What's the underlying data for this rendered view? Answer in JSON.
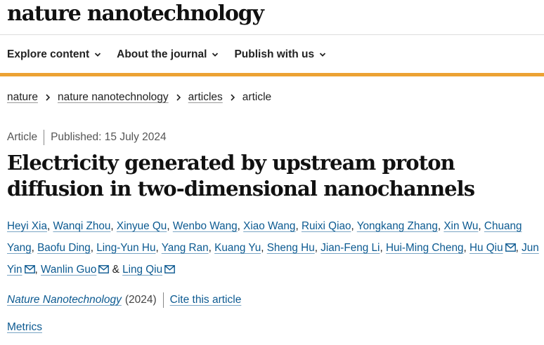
{
  "site": {
    "logo": "nature nanotechnology"
  },
  "nav": {
    "items": [
      {
        "label": "Explore content"
      },
      {
        "label": "About the journal"
      },
      {
        "label": "Publish with us"
      }
    ]
  },
  "breadcrumb": {
    "items": [
      "nature",
      "nature nanotechnology",
      "articles"
    ],
    "current": "article"
  },
  "article": {
    "type": "Article",
    "published": "Published: 15 July 2024",
    "title": "Electricity generated by upstream proton diffusion in two-dimensional nanochannels",
    "authors": [
      {
        "name": "Heyi Xia",
        "sep": ", ",
        "email": false
      },
      {
        "name": "Wanqi Zhou",
        "sep": ", ",
        "email": false
      },
      {
        "name": "Xinyue Qu",
        "sep": ", ",
        "email": false
      },
      {
        "name": "Wenbo Wang",
        "sep": ", ",
        "email": false
      },
      {
        "name": "Xiao Wang",
        "sep": ", ",
        "email": false
      },
      {
        "name": "Ruixi Qiao",
        "sep": ", ",
        "email": false
      },
      {
        "name": "Yongkang Zhang",
        "sep": ", ",
        "email": false
      },
      {
        "name": "Xin Wu",
        "sep": ", ",
        "email": false
      },
      {
        "name": "Chuang Yang",
        "sep": ", ",
        "email": false
      },
      {
        "name": "Baofu Ding",
        "sep": ", ",
        "email": false
      },
      {
        "name": "Ling-Yun Hu",
        "sep": ", ",
        "email": false
      },
      {
        "name": "Yang Ran",
        "sep": ", ",
        "email": false
      },
      {
        "name": "Kuang Yu",
        "sep": ", ",
        "email": false
      },
      {
        "name": "Sheng Hu",
        "sep": ", ",
        "email": false
      },
      {
        "name": "Jian-Feng Li",
        "sep": ", ",
        "email": false
      },
      {
        "name": "Hui-Ming Cheng",
        "sep": ", ",
        "email": false
      },
      {
        "name": "Hu Qiu",
        "sep": ", ",
        "email": true
      },
      {
        "name": "Jun Yin",
        "sep": ", ",
        "email": true
      },
      {
        "name": "Wanlin Guo",
        "sep": " & ",
        "email": true
      },
      {
        "name": "Ling Qiu",
        "sep": "",
        "email": true
      }
    ],
    "journal": "Nature Nanotechnology",
    "year": "(2024)",
    "cite_label": "Cite this article",
    "metrics_label": "Metrics"
  },
  "colors": {
    "accent_bar": "#eca233",
    "link": "#0c5a91"
  },
  "icons": {
    "nav_chevron": "chevron-down-icon",
    "breadcrumb_separator": "chevron-right-icon",
    "author_email": "envelope-icon"
  }
}
